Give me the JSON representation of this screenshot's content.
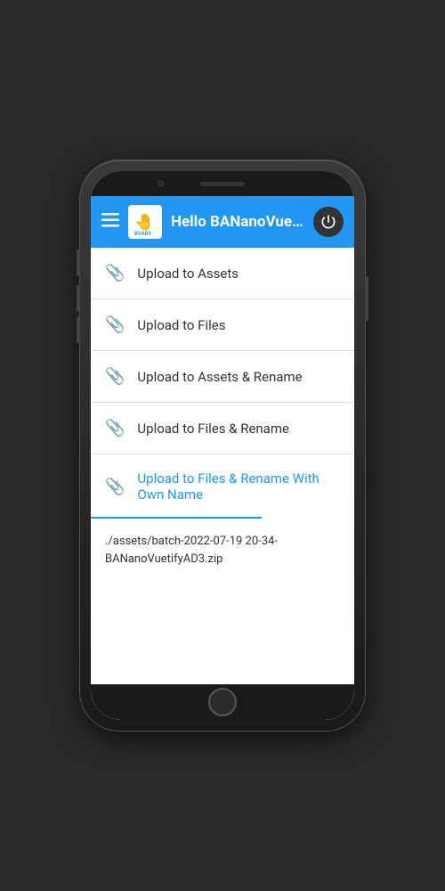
{
  "header": {
    "title": "Hello BANanoVue...",
    "hamburger_label": "☰",
    "power_label": "⏻"
  },
  "menu_items": [
    {
      "id": "upload-assets",
      "label": "Upload to Assets",
      "active": false
    },
    {
      "id": "upload-files",
      "label": "Upload to Files",
      "active": false
    },
    {
      "id": "upload-assets-rename",
      "label": "Upload to Assets & Rename",
      "active": false
    },
    {
      "id": "upload-files-rename",
      "label": "Upload to Files & Rename",
      "active": false
    },
    {
      "id": "upload-files-rename-own",
      "label": "Upload to Files & Rename With Own Name",
      "active": true
    }
  ],
  "output": {
    "text": "./assets/batch-2022-07-19 20-34-BANanoVuetifyAD3.zip"
  }
}
